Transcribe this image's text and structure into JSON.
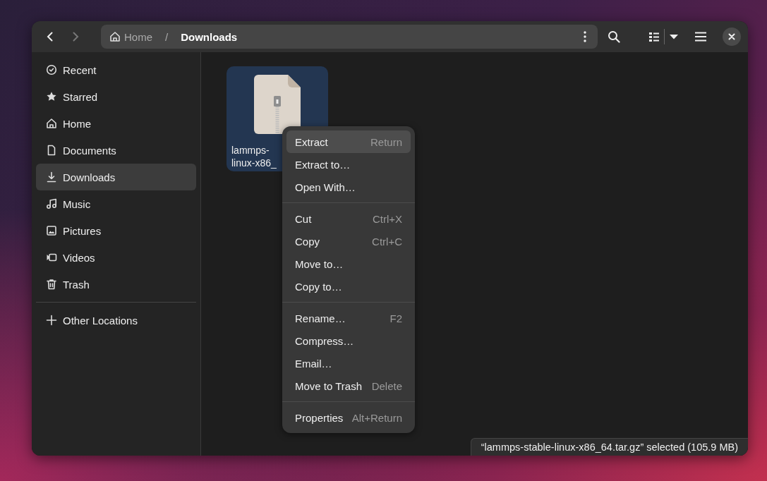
{
  "header": {
    "separator": "/",
    "path": [
      {
        "label": "Home",
        "kind": "home",
        "current": false
      },
      {
        "label": "Downloads",
        "kind": "folder",
        "current": true
      }
    ]
  },
  "sidebar": {
    "items": [
      {
        "label": "Recent",
        "kind": "recent",
        "selected": false
      },
      {
        "label": "Starred",
        "kind": "starred",
        "selected": false
      },
      {
        "label": "Home",
        "kind": "home",
        "selected": false
      },
      {
        "label": "Documents",
        "kind": "documents",
        "selected": false
      },
      {
        "label": "Downloads",
        "kind": "downloads",
        "selected": true
      },
      {
        "label": "Music",
        "kind": "music",
        "selected": false
      },
      {
        "label": "Pictures",
        "kind": "pictures",
        "selected": false
      },
      {
        "label": "Videos",
        "kind": "videos",
        "selected": false
      },
      {
        "label": "Trash",
        "kind": "trash",
        "selected": false
      }
    ],
    "other_locations": "Other Locations"
  },
  "files": [
    {
      "name_lines": [
        "lammps-",
        "linux-x86_"
      ],
      "kind": "archive",
      "selected": true
    }
  ],
  "context_menu": {
    "sections": [
      [
        {
          "label": "Extract",
          "shortcut": "Return",
          "selected": true
        },
        {
          "label": "Extract to…",
          "selected": false
        },
        {
          "label": "Open With…",
          "selected": false
        }
      ],
      [
        {
          "label": "Cut",
          "shortcut": "Ctrl+X",
          "selected": false
        },
        {
          "label": "Copy",
          "shortcut": "Ctrl+C",
          "selected": false
        },
        {
          "label": "Move to…",
          "selected": false
        },
        {
          "label": "Copy to…",
          "selected": false
        }
      ],
      [
        {
          "label": "Rename…",
          "shortcut": "F2",
          "selected": false
        },
        {
          "label": "Compress…",
          "selected": false
        },
        {
          "label": "Email…",
          "selected": false
        },
        {
          "label": "Move to Trash",
          "shortcut": "Delete",
          "selected": false
        }
      ],
      [
        {
          "label": "Properties",
          "shortcut": "Alt+Return",
          "selected": false
        }
      ]
    ]
  },
  "status_bar": "“lammps-stable-linux-x86_64.tar.gz” selected (105.9 MB)"
}
